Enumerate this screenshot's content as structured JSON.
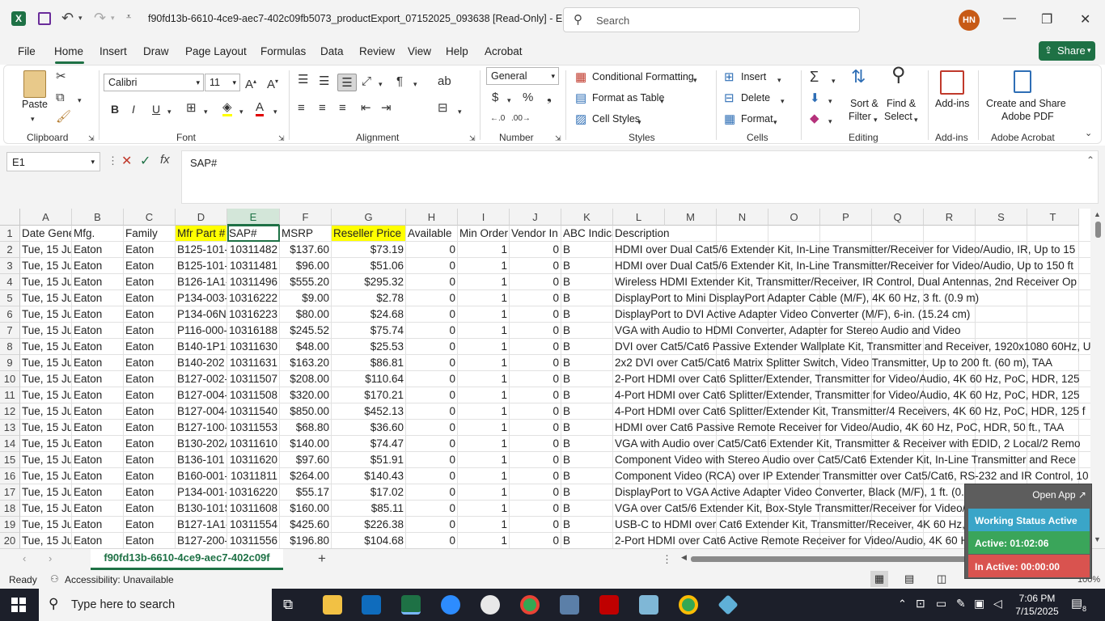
{
  "titlebar": {
    "filename": "f90fd13b-6610-4ce9-aec7-402c09fb5073_productExport_07152025_093638  [Read-Only]  -  E...",
    "search_placeholder": "Search",
    "avatar": "HN"
  },
  "menu": {
    "tabs": [
      "File",
      "Home",
      "Insert",
      "Draw",
      "Page Layout",
      "Formulas",
      "Data",
      "Review",
      "View",
      "Help",
      "Acrobat"
    ],
    "share": "Share"
  },
  "ribbon": {
    "paste": "Paste",
    "clipboard": "Clipboard",
    "font_name": "Calibri",
    "font_size": "11",
    "font": "Font",
    "alignment": "Alignment",
    "number_format": "General",
    "number": "Number",
    "conditional_formatting": "Conditional Formatting",
    "format_as_table": "Format as Table",
    "cell_styles": "Cell Styles",
    "styles": "Styles",
    "insert": "Insert",
    "delete": "Delete",
    "format": "Format",
    "cells": "Cells",
    "sort_filter_1": "Sort &",
    "sort_filter_2": "Filter",
    "find_select_1": "Find &",
    "find_select_2": "Select",
    "editing": "Editing",
    "addins": "Add-ins",
    "addins_group": "Add-ins",
    "create_pdf_1": "Create and Share",
    "create_pdf_2": "Adobe PDF",
    "acrobat_group": "Adobe Acrobat",
    "bold": "B",
    "italic": "I",
    "underline": "U"
  },
  "formula_bar": {
    "name_box": "E1",
    "fx": "fx",
    "content": "SAP#"
  },
  "grid": {
    "columns": [
      "A",
      "B",
      "C",
      "D",
      "E",
      "F",
      "G",
      "H",
      "I",
      "J",
      "K",
      "L",
      "M",
      "N",
      "O",
      "P",
      "Q",
      "R",
      "S",
      "T"
    ],
    "header_row": [
      "Date Gene",
      "Mfg.",
      "Family",
      "Mfr Part #",
      "SAP#",
      "MSRP",
      "Reseller Price",
      "Available",
      "Min Order",
      "Vendor In",
      "ABC Indica",
      "Description"
    ],
    "rows": [
      [
        "Tue, 15 Ju",
        "Eaton",
        "Eaton",
        "B125-101-",
        "10311482",
        "$137.60",
        "$73.19",
        "0",
        "1",
        "0",
        "B",
        "HDMI over Dual Cat5/6 Extender Kit, In-Line Transmitter/Receiver for Video/Audio, IR, Up to 15"
      ],
      [
        "Tue, 15 Ju",
        "Eaton",
        "Eaton",
        "B125-101-",
        "10311481",
        "$96.00",
        "$51.06",
        "0",
        "1",
        "0",
        "B",
        "HDMI over Dual Cat5/6 Extender Kit, In-Line Transmitter/Receiver for Video/Audio, Up to 150 ft"
      ],
      [
        "Tue, 15 Ju",
        "Eaton",
        "Eaton",
        "B126-1A1-",
        "10311496",
        "$555.20",
        "$295.32",
        "0",
        "1",
        "0",
        "B",
        "Wireless HDMI Extender Kit, Transmitter/Receiver, IR Control, Dual Antennas, 2nd Receiver Op"
      ],
      [
        "Tue, 15 Ju",
        "Eaton",
        "Eaton",
        "P134-003-",
        "10316222",
        "$9.00",
        "$2.78",
        "0",
        "1",
        "0",
        "B",
        "DisplayPort to Mini DisplayPort Adapter Cable (M/F), 4K 60 Hz, 3 ft. (0.9 m)"
      ],
      [
        "Tue, 15 Ju",
        "Eaton",
        "Eaton",
        "P134-06N-",
        "10316223",
        "$80.00",
        "$24.68",
        "0",
        "1",
        "0",
        "B",
        "DisplayPort to DVI Active Adapter Video Converter (M/F), 6-in. (15.24 cm)"
      ],
      [
        "Tue, 15 Ju",
        "Eaton",
        "Eaton",
        "P116-000-",
        "10316188",
        "$245.52",
        "$75.74",
        "0",
        "1",
        "0",
        "B",
        "VGA with Audio to HDMI Converter, Adapter for Stereo Audio and Video"
      ],
      [
        "Tue, 15 Ju",
        "Eaton",
        "Eaton",
        "B140-1P1-",
        "10311630",
        "$48.00",
        "$25.53",
        "0",
        "1",
        "0",
        "B",
        "DVI over Cat5/Cat6 Passive Extender Wallplate Kit, Transmitter and Receiver, 1920x1080 60Hz, U"
      ],
      [
        "Tue, 15 Ju",
        "Eaton",
        "Eaton",
        "B140-202",
        "10311631",
        "$163.20",
        "$86.81",
        "0",
        "1",
        "0",
        "B",
        "2x2 DVI over Cat5/Cat6 Matrix Splitter Switch, Video Transmitter, Up to 200 ft. (60 m), TAA"
      ],
      [
        "Tue, 15 Ju",
        "Eaton",
        "Eaton",
        "B127-002-",
        "10311507",
        "$208.00",
        "$110.64",
        "0",
        "1",
        "0",
        "B",
        "2-Port HDMI over Cat6 Splitter/Extender, Transmitter for Video/Audio, 4K  60 Hz, PoC, HDR, 125"
      ],
      [
        "Tue, 15 Ju",
        "Eaton",
        "Eaton",
        "B127-004-",
        "10311508",
        "$320.00",
        "$170.21",
        "0",
        "1",
        "0",
        "B",
        "4-Port HDMI over Cat6 Splitter/Extender, Transmitter for Video/Audio, 4K  60 Hz, PoC, HDR, 125"
      ],
      [
        "Tue, 15 Ju",
        "Eaton",
        "Eaton",
        "B127-004-",
        "10311540",
        "$850.00",
        "$452.13",
        "0",
        "1",
        "0",
        "B",
        "4-Port HDMI over Cat6 Splitter/Extender Kit, Transmitter/4 Receivers, 4K  60 Hz, PoC, HDR, 125 f"
      ],
      [
        "Tue, 15 Ju",
        "Eaton",
        "Eaton",
        "B127-100-",
        "10311553",
        "$68.80",
        "$36.60",
        "0",
        "1",
        "0",
        "B",
        "HDMI over Cat6 Passive Remote Receiver for Video/Audio, 4K 60 Hz, PoC, HDR, 50 ft., TAA"
      ],
      [
        "Tue, 15 Ju",
        "Eaton",
        "Eaton",
        "B130-202A",
        "10311610",
        "$140.00",
        "$74.47",
        "0",
        "1",
        "0",
        "B",
        "VGA with Audio over Cat5/Cat6 Extender Kit, Transmitter & Receiver with EDID, 2 Local/2 Remo"
      ],
      [
        "Tue, 15 Ju",
        "Eaton",
        "Eaton",
        "B136-101",
        "10311620",
        "$97.60",
        "$51.91",
        "0",
        "1",
        "0",
        "B",
        "Component Video with Stereo Audio over Cat5/Cat6 Extender Kit, In-Line Transmitter and Rece"
      ],
      [
        "Tue, 15 Ju",
        "Eaton",
        "Eaton",
        "B160-001-",
        "10311811",
        "$264.00",
        "$140.43",
        "0",
        "1",
        "0",
        "B",
        "Component Video (RCA) over IP Extender Transmitter over Cat5/Cat6, RS-232 and IR Control, 10"
      ],
      [
        "Tue, 15 Ju",
        "Eaton",
        "Eaton",
        "P134-001-",
        "10316220",
        "$55.17",
        "$17.02",
        "0",
        "1",
        "0",
        "B",
        "DisplayPort to VGA Active Adapter Video Converter, Black (M/F), 1 ft. (0.31 m)"
      ],
      [
        "Tue, 15 Ju",
        "Eaton",
        "Eaton",
        "B130-101S",
        "10311608",
        "$160.00",
        "$85.11",
        "0",
        "1",
        "0",
        "B",
        "VGA over Cat5/6 Extender Kit, Box-Style Transmitter/Receiver for Video/RS-232, Up to 1000 ft. ("
      ],
      [
        "Tue, 15 Ju",
        "Eaton",
        "Eaton",
        "B127-1A1-",
        "10311554",
        "$425.60",
        "$226.38",
        "0",
        "1",
        "0",
        "B",
        "USB-C to HDMI over Cat6 Extender Kit, Transmitter/Receiver, 4K 60 Hz, PoC, HDR, 60W PD Charg"
      ],
      [
        "Tue, 15 Ju",
        "Eaton",
        "Eaton",
        "B127-200-",
        "10311556",
        "$196.80",
        "$104.68",
        "0",
        "1",
        "0",
        "B",
        "2-Port HDMI over Cat6 Active Remote Receiver for Video/Audio, 4K 60 Hz, HDR, 125 ft., TAA"
      ]
    ]
  },
  "sheet_tabs": {
    "active": "f90fd13b-6610-4ce9-aec7-402c09f",
    "add": "+"
  },
  "status": {
    "ready": "Ready",
    "accessibility": "Accessibility: Unavailable",
    "zoom": "100%"
  },
  "widget": {
    "open_app": "Open App ↗",
    "working": "Working Status Active",
    "active": "Active: 01:02:06",
    "inactive": "In Active: 00:00:00"
  },
  "taskbar": {
    "search_placeholder": "Type here to search",
    "time": "7:06 PM",
    "date": "7/15/2025",
    "notifications": "8"
  },
  "colors": {
    "accent": "#1e7145",
    "highlight": "#ffff00",
    "widget_active": "#3aa55a",
    "widget_inactive": "#d9534f"
  }
}
